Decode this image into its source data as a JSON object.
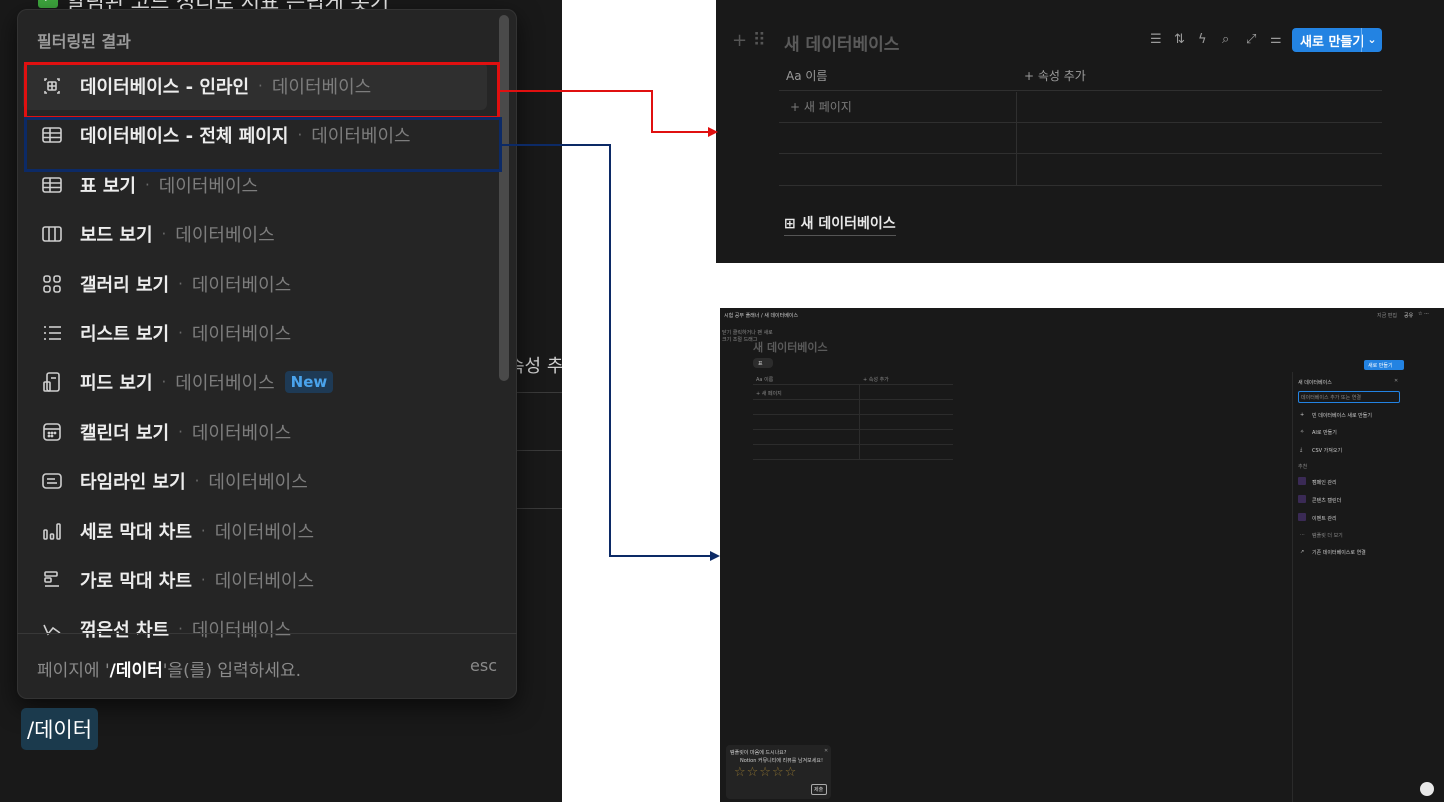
{
  "left": {
    "background_heading": "알림된 코드 성리로 서표 는립게 롯기",
    "background_property": "속성 추",
    "menu": {
      "heading": "필터링된 결과",
      "items": [
        {
          "name": "데이터베이스 - 인라인",
          "source": "데이터베이스",
          "icon": "inline-database-icon",
          "selected": true
        },
        {
          "name": "데이터베이스 - 전체 페이지",
          "source": "데이터베이스",
          "icon": "table-icon"
        },
        {
          "name": "표 보기",
          "source": "데이터베이스",
          "icon": "table-icon"
        },
        {
          "name": "보드 보기",
          "source": "데이터베이스",
          "icon": "board-icon"
        },
        {
          "name": "갤러리 보기",
          "source": "데이터베이스",
          "icon": "gallery-icon"
        },
        {
          "name": "리스트 보기",
          "source": "데이터베이스",
          "icon": "list-icon"
        },
        {
          "name": "피드 보기",
          "source": "데이터베이스",
          "icon": "feed-icon",
          "badge": "New"
        },
        {
          "name": "캘린더 보기",
          "source": "데이터베이스",
          "icon": "calendar-icon"
        },
        {
          "name": "타임라인 보기",
          "source": "데이터베이스",
          "icon": "timeline-icon"
        },
        {
          "name": "세로 막대 차트",
          "source": "데이터베이스",
          "icon": "bar-chart-icon"
        },
        {
          "name": "가로 막대 차트",
          "source": "데이터베이스",
          "icon": "horizontal-bar-chart-icon"
        },
        {
          "name": "꺾은선 차트",
          "source": "데이터베이스",
          "icon": "line-chart-icon"
        }
      ],
      "footer_prefix": "페이지에 '",
      "footer_query": "/데이터",
      "footer_suffix": "'을(를) 입력하세요.",
      "esc": "esc"
    },
    "slash_command": "/데이터"
  },
  "top_right": {
    "title": "새 데이터베이스",
    "new_button": "새로 만들기",
    "columns": [
      "Aa 이름",
      "+ 속성 추가"
    ],
    "new_page": "+ 새 페이지",
    "database_link": "새 데이터베이스"
  },
  "bottom_right": {
    "breadcrumb": [
      "시험 공부 플래너",
      "새 데이터베이스"
    ],
    "top_actions": [
      "지금 편집",
      "공유"
    ],
    "side_hint_1": "닫기 클릭하거나 팬 새로",
    "side_hint_2": "크기 조절 드래그",
    "title": "새 데이터베이스",
    "view_tab": "표",
    "columns": [
      "Aa 이름",
      "+ 속성 추가"
    ],
    "new_page": "+ 새 페이지",
    "new_button": "새로 만들기",
    "panel": {
      "title": "새 데이터베이스",
      "input_placeholder": "데이터베이스 추가 또는 연결",
      "actions": [
        "빈 데이터베이스 새로 만들기",
        "AI로 만들기",
        "CSV 가져오기"
      ],
      "suggested_label": "추천",
      "suggested": [
        "캠페인 관리",
        "콘텐츠 캘린더",
        "이벤트 관리"
      ],
      "more": "템플릿 더 보기",
      "link_existing": "기존 데이터베이스로 연결"
    },
    "survey": {
      "question": "템플릿이 마음에 드시나요?",
      "subtext": "Notion 커뮤니티에 리뷰를 남겨보세요!",
      "stars": "☆☆☆☆☆",
      "submit": "제출"
    }
  },
  "colors": {
    "red": "#e01010",
    "navy": "#0c2a66",
    "accent": "#2383e2"
  }
}
